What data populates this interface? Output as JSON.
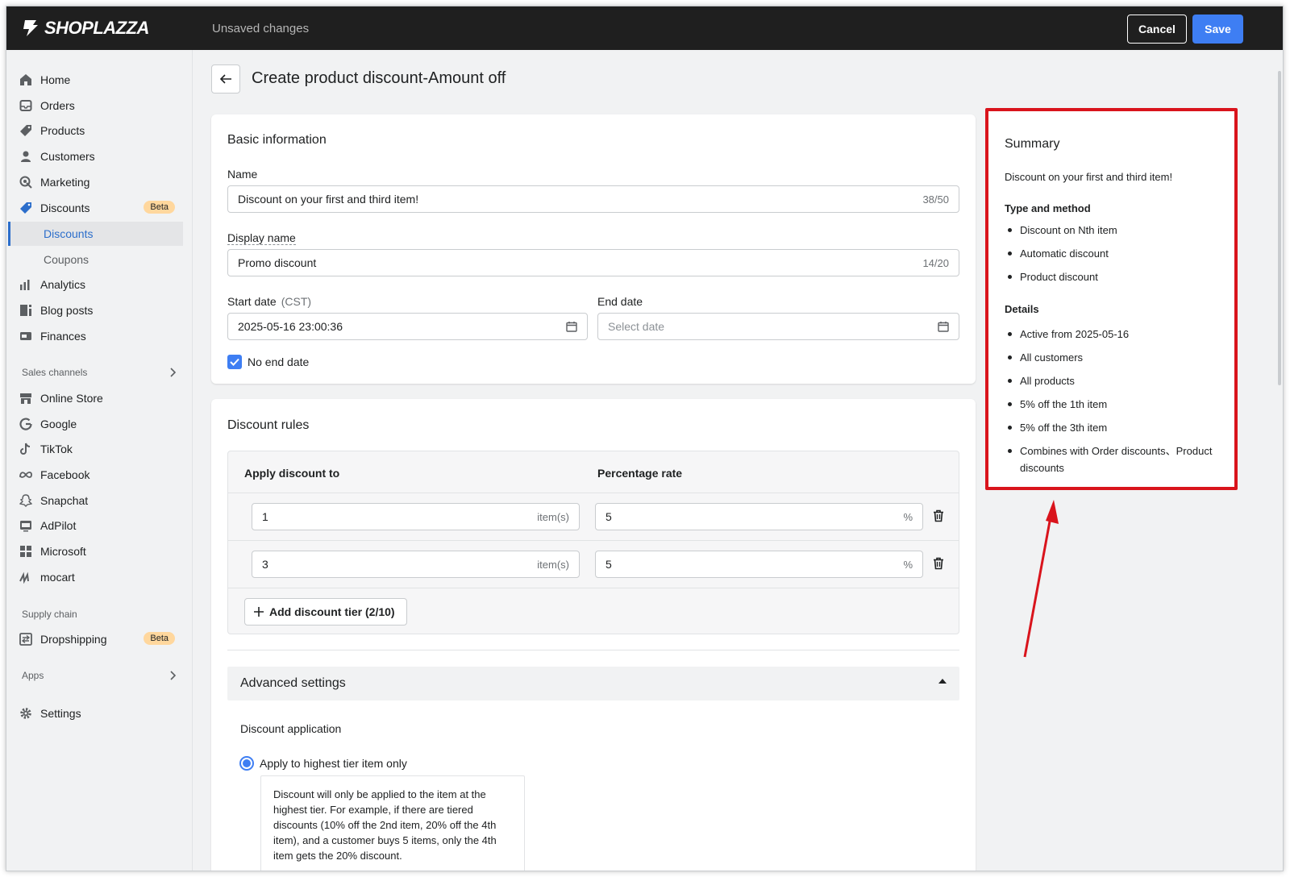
{
  "header": {
    "brand": "SHOPLAZZA",
    "status": "Unsaved changes",
    "cancel_label": "Cancel",
    "save_label": "Save"
  },
  "sidebar": {
    "items": [
      {
        "label": "Home",
        "icon": "home-icon"
      },
      {
        "label": "Orders",
        "icon": "inbox-icon"
      },
      {
        "label": "Products",
        "icon": "tag-icon"
      },
      {
        "label": "Customers",
        "icon": "person-icon"
      },
      {
        "label": "Marketing",
        "icon": "target-icon"
      },
      {
        "label": "Discounts",
        "icon": "discount-icon",
        "badge": "Beta"
      }
    ],
    "sub_items": [
      {
        "label": "Discounts",
        "active": true
      },
      {
        "label": "Coupons",
        "active": false
      }
    ],
    "items2": [
      {
        "label": "Analytics",
        "icon": "bar-chart-icon"
      },
      {
        "label": "Blog posts",
        "icon": "blog-icon"
      },
      {
        "label": "Finances",
        "icon": "finance-icon"
      }
    ],
    "sales_channels_label": "Sales channels",
    "channels": [
      {
        "label": "Online Store",
        "icon": "store-icon"
      },
      {
        "label": "Google",
        "icon": "google-icon"
      },
      {
        "label": "TikTok",
        "icon": "tiktok-icon"
      },
      {
        "label": "Facebook",
        "icon": "meta-icon"
      },
      {
        "label": "Snapchat",
        "icon": "snapchat-icon"
      },
      {
        "label": "AdPilot",
        "icon": "adpilot-icon"
      },
      {
        "label": "Microsoft",
        "icon": "microsoft-icon"
      },
      {
        "label": "mocart",
        "icon": "mocart-icon"
      }
    ],
    "supply_chain_label": "Supply chain",
    "supply": [
      {
        "label": "Dropshipping",
        "icon": "dropshipping-icon",
        "badge": "Beta"
      }
    ],
    "apps_label": "Apps",
    "settings_label": "Settings"
  },
  "page": {
    "title": "Create product discount-Amount off"
  },
  "basic_info": {
    "title": "Basic information",
    "name_label": "Name",
    "name_value": "Discount on your first and third item!",
    "name_count": "38/50",
    "display_label": "Display name",
    "display_value": "Promo discount",
    "display_count": "14/20",
    "start_label": "Start date",
    "start_tz": "(CST)",
    "start_value": "2025-05-16 23:00:36",
    "end_label": "End date",
    "end_placeholder": "Select date",
    "no_end_label": "No end date"
  },
  "rules": {
    "title": "Discount rules",
    "col_apply": "Apply discount to",
    "col_rate": "Percentage rate",
    "rows": [
      {
        "items": "1",
        "items_suffix": "item(s)",
        "rate": "5",
        "rate_suffix": "%"
      },
      {
        "items": "3",
        "items_suffix": "item(s)",
        "rate": "5",
        "rate_suffix": "%"
      }
    ],
    "add_label": "Add discount tier (2/10)"
  },
  "advanced": {
    "title": "Advanced settings",
    "application_label": "Discount application",
    "option_label": "Apply to highest tier item only",
    "help_text": "Discount will only be applied to the item at the highest tier. For example, if there are tiered discounts (10% off the 2nd item, 20% off the 4th item), and a customer buys 5 items, only the 4th item gets the 20% discount."
  },
  "summary": {
    "title": "Summary",
    "name": "Discount on your first and third item!",
    "type_heading": "Type and method",
    "type_items": [
      "Discount on Nth item",
      "Automatic discount",
      "Product discount"
    ],
    "details_heading": "Details",
    "details_items": [
      "Active from 2025-05-16",
      "All customers",
      "All products",
      "5% off the 1th item",
      "5% off the 3th item",
      "Combines with Order discounts、Product discounts"
    ]
  },
  "colors": {
    "accent": "#3e7ef3",
    "highlight_border": "#d9141c",
    "beta_badge": "#ffd79d",
    "topbar": "#1f1f1f"
  }
}
